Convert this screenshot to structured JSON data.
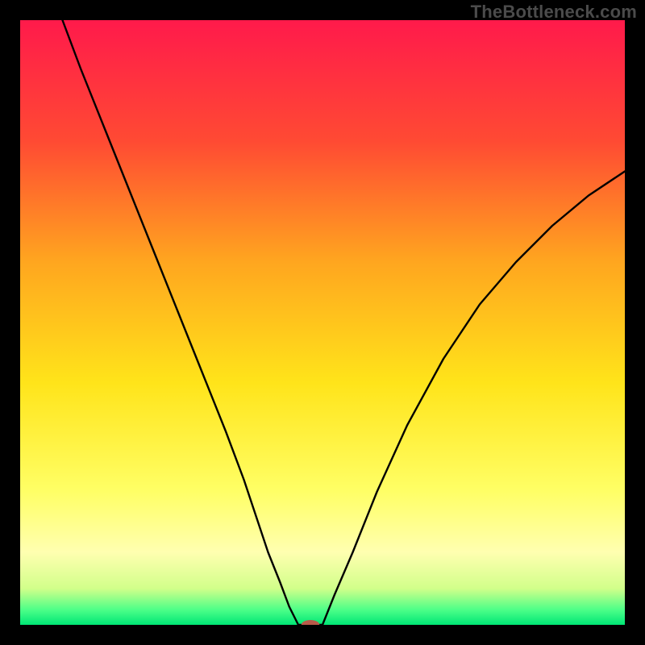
{
  "watermark": "TheBottleneck.com",
  "chart_data": {
    "type": "line",
    "title": "",
    "xlabel": "",
    "ylabel": "",
    "xlim": [
      0,
      100
    ],
    "ylim": [
      0,
      100
    ],
    "grid": false,
    "legend": false,
    "background_gradient_stops": [
      {
        "offset": 0.0,
        "color": "#ff1a4b"
      },
      {
        "offset": 0.2,
        "color": "#ff4a33"
      },
      {
        "offset": 0.4,
        "color": "#ffa61f"
      },
      {
        "offset": 0.6,
        "color": "#ffe41a"
      },
      {
        "offset": 0.78,
        "color": "#ffff66"
      },
      {
        "offset": 0.88,
        "color": "#ffffb0"
      },
      {
        "offset": 0.94,
        "color": "#d2ff8a"
      },
      {
        "offset": 0.975,
        "color": "#4dff88"
      },
      {
        "offset": 1.0,
        "color": "#00e676"
      }
    ],
    "series": [
      {
        "name": "curve-left",
        "x": [
          7,
          10,
          14,
          18,
          22,
          26,
          30,
          34,
          37,
          39,
          41,
          43,
          44.5,
          45.5,
          46
        ],
        "y": [
          100,
          92,
          82,
          72,
          62,
          52,
          42,
          32,
          24,
          18,
          12,
          7,
          3,
          1,
          0
        ]
      },
      {
        "name": "floor",
        "x": [
          46,
          50
        ],
        "y": [
          0,
          0
        ]
      },
      {
        "name": "curve-right",
        "x": [
          50,
          52,
          55,
          59,
          64,
          70,
          76,
          82,
          88,
          94,
          100
        ],
        "y": [
          0,
          5,
          12,
          22,
          33,
          44,
          53,
          60,
          66,
          71,
          75
        ]
      }
    ],
    "marker": {
      "x": 48,
      "y": 0,
      "rx": 1.5,
      "ry": 0.8,
      "color": "#b85a4a"
    },
    "line_color": "#000000",
    "line_width": 2.4
  }
}
